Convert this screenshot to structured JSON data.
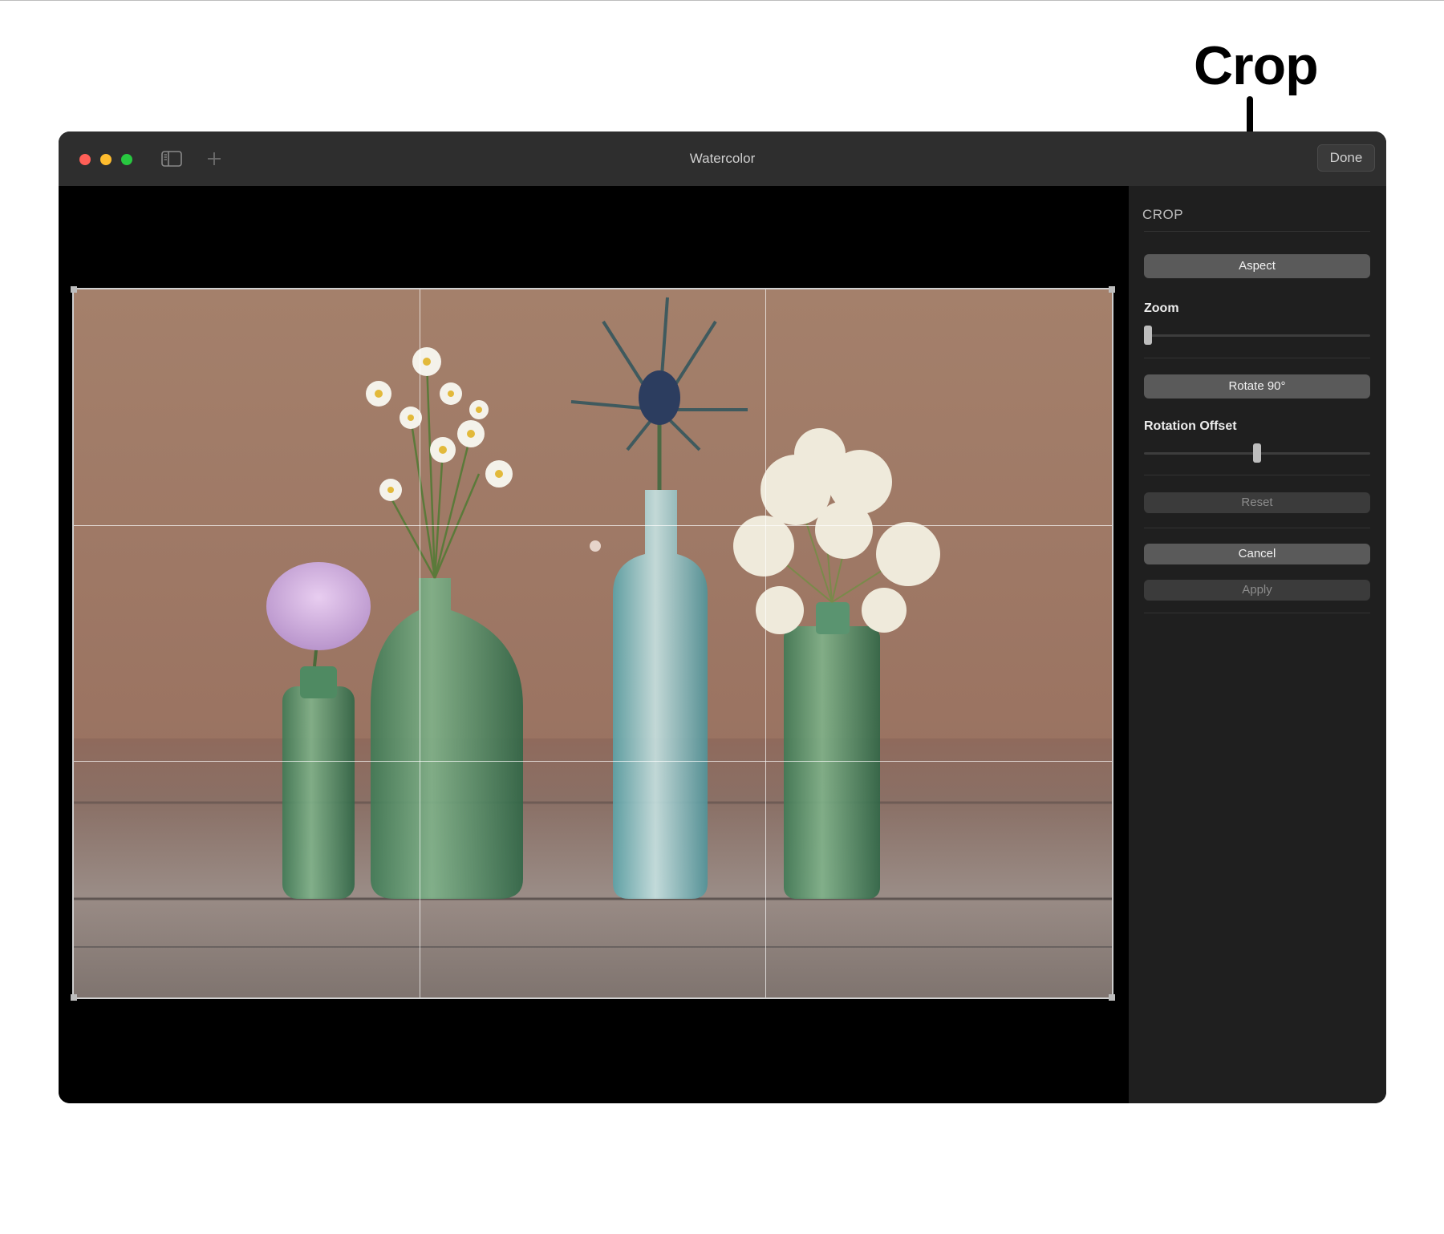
{
  "callout": {
    "label": "Crop"
  },
  "window": {
    "title": "Watercolor",
    "done_label": "Done"
  },
  "toolbar": {
    "sidebar_icon": "sidebar-toggle-icon",
    "add_icon": "plus-icon"
  },
  "panel": {
    "heading": "CROP",
    "aspect_label": "Aspect",
    "zoom_label": "Zoom",
    "zoom_value": 0.0,
    "rotate_label": "Rotate 90°",
    "rotation_offset_label": "Rotation Offset",
    "rotation_offset_value": 0.5,
    "reset_label": "Reset",
    "cancel_label": "Cancel",
    "apply_label": "Apply"
  },
  "photo": {
    "subject": "bottles-with-flowers-image"
  }
}
